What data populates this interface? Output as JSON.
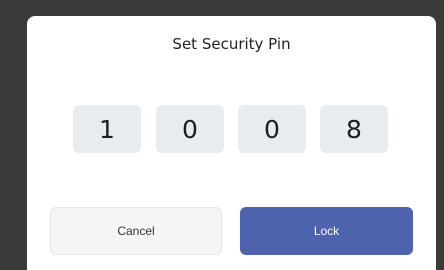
{
  "dialog": {
    "title": "Set Security Pin",
    "pin_digits": [
      "1",
      "0",
      "0",
      "8"
    ],
    "cancel_label": "Cancel",
    "lock_label": "Lock"
  },
  "colors": {
    "accent": "#4e62ae",
    "pin_box": "#e8ebef",
    "backdrop": "#3a3a3a"
  }
}
